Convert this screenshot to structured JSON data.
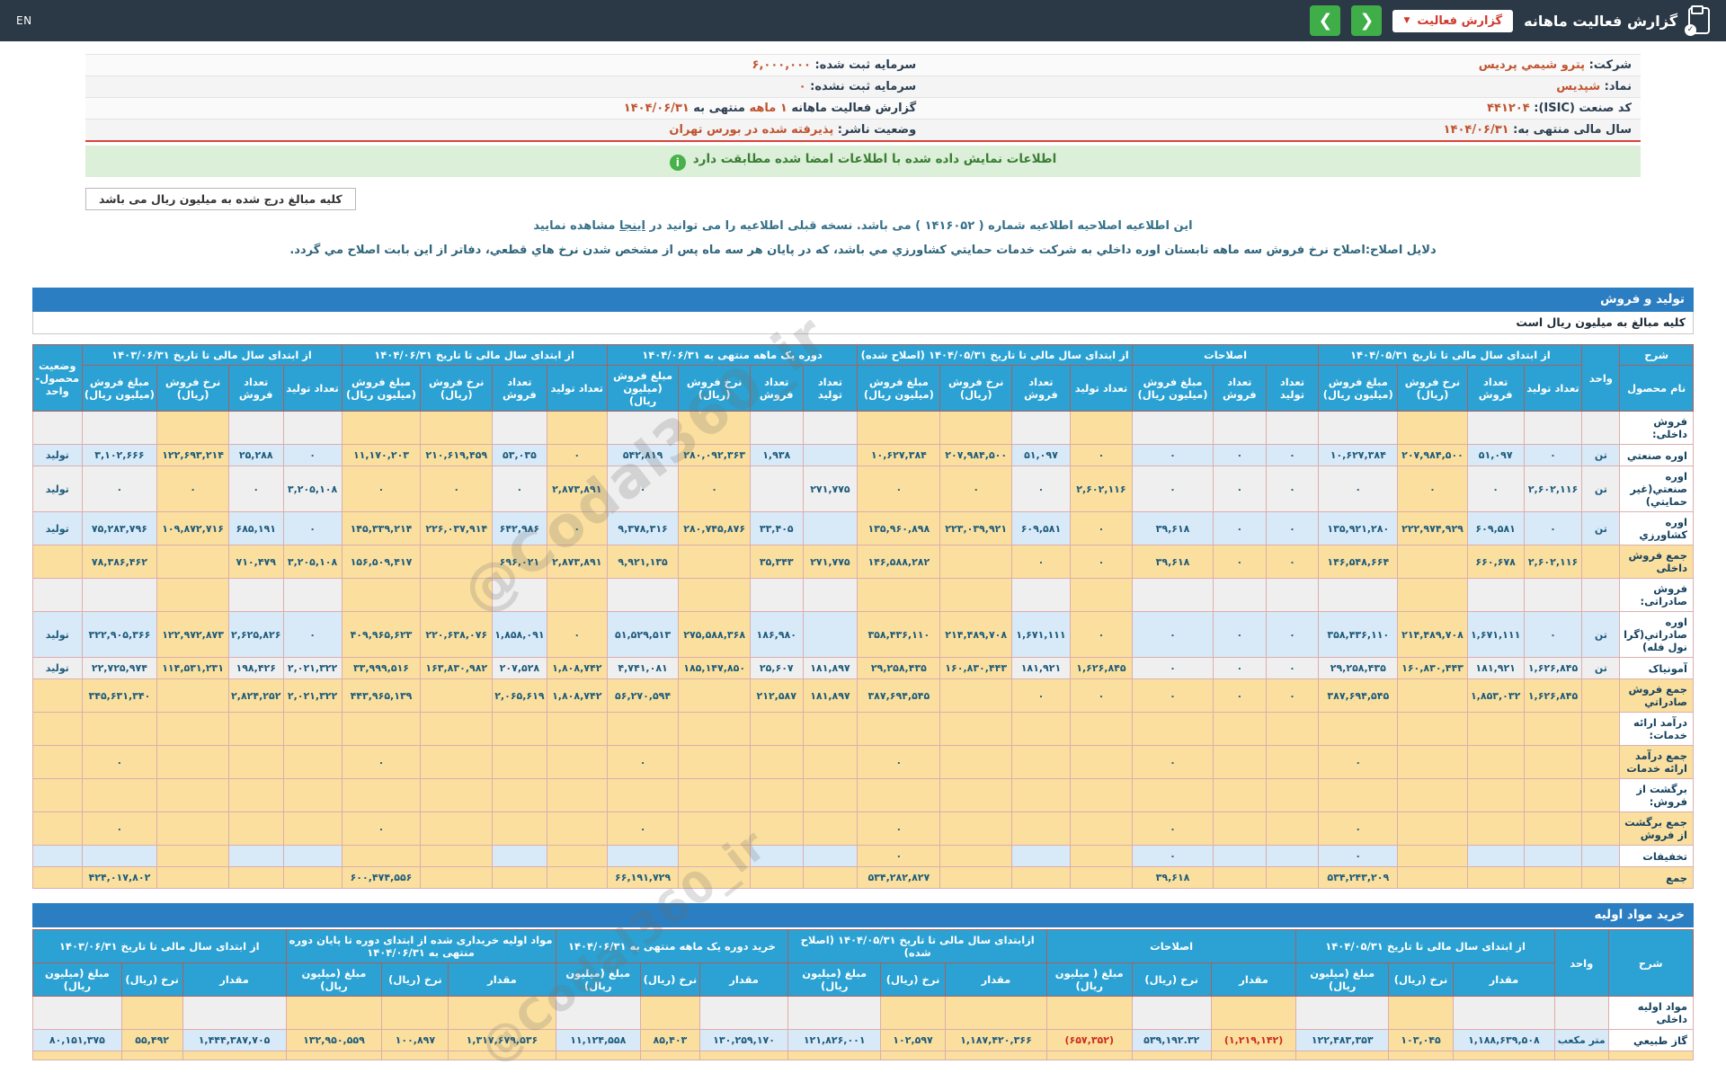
{
  "topbar": {
    "title": "گزارش فعالیت ماهانه",
    "dropdown_label": "گزارش فعالیت",
    "lang": "EN"
  },
  "info_rows": [
    {
      "r_label": "شرکت:",
      "r_value": "پترو شیمي پردیس",
      "l_label": "سرمایه ثبت شده:",
      "l_value": "۶,۰۰۰,۰۰۰"
    },
    {
      "r_label": "نماد:",
      "r_value": "شپدیس",
      "l_label": "سرمایه ثبت نشده:",
      "l_value": "۰"
    },
    {
      "r_label": "کد صنعت (ISIC):",
      "r_value": "۴۴۱۲۰۴",
      "l_label": "گزارش فعالیت ماهانه",
      "l_value": "۱ ماهه",
      "l_label2": "منتهی به",
      "l_value2": "۱۴۰۴/۰۶/۳۱"
    },
    {
      "r_label": "سال مالی منتهی به:",
      "r_value": "۱۴۰۴/۰۶/۳۱",
      "l_label": "وضعیت ناشر:",
      "l_value": "پذیرفته شده در بورس تهران"
    }
  ],
  "notice_text": "اطلاعات نمایش داده شده با اطلاعات امضا شده مطابقت دارد",
  "unit_note": "کلیه مبالغ درج شده به میلیون ریال می باشد",
  "amendment": {
    "before_link": "این اطلاعیه اصلاحیه اطلاعیه شماره ( ۱۴۱۶۰۵۲ ) می باشد. نسخه قبلی اطلاعیه را می توانید در ",
    "link_text": "اینجا",
    "after_link": " مشاهده نمایید",
    "reason": "دلایل اصلاح:اصلاح نرخ فروش سه ماهه تابستان اوره داخلي به شرکت خدمات حمایتي کشاورزي مي باشد، که در پایان هر سه ماه پس از مشخص شدن نرخ هاي قطعي، دفاتر از این بابت اصلاح مي گردد."
  },
  "watermark": "@Codal360_ir",
  "colors": {
    "accent_green": "#3fae49",
    "accent_red": "#cf3a2e",
    "header_cyan": "#2ba2d3",
    "bar_blue": "#2b7ec1",
    "wheat": "#fbdf9e"
  },
  "sales": {
    "bar_title": "تولید و فروش",
    "subtitle": "کلیه مبالغ به میلیون ریال است",
    "groups": [
      {
        "title": "شرح",
        "subs": [
          "نام محصول"
        ]
      },
      {
        "title": "واحد",
        "subs": []
      },
      {
        "title": "از ابتدای سال مالی تا تاریخ ۱۴۰۴/۰۵/۳۱",
        "subs": [
          "تعداد تولید",
          "تعداد فروش",
          "نرخ فروش (ریال)",
          "مبلغ فروش (میلیون ریال)"
        ]
      },
      {
        "title": "اصلاحات",
        "subs": [
          "تعداد تولید",
          "تعداد فروش",
          "مبلغ فروش (میلیون ریال)"
        ]
      },
      {
        "title": "از ابتدای سال مالی تا تاریخ ۱۴۰۴/۰۵/۳۱ (اصلاح شده)",
        "subs": [
          "تعداد تولید",
          "تعداد فروش",
          "نرخ فروش (ریال)",
          "مبلغ فروش (میلیون ریال)"
        ]
      },
      {
        "title": "دوره یک ماهه منتهی به ۱۴۰۴/۰۶/۳۱",
        "subs": [
          "تعداد تولید",
          "تعداد فروش",
          "نرخ فروش (ریال)",
          "مبلغ فروش (میلیون ریال)"
        ]
      },
      {
        "title": "از ابتدای سال مالی تا تاریخ ۱۴۰۴/۰۶/۳۱",
        "subs": [
          "تعداد تولید",
          "تعداد فروش",
          "نرخ فروش (ریال)",
          "مبلغ فروش (میلیون ریال)"
        ]
      },
      {
        "title": "از ابتدای سال مالی تا تاریخ ۱۴۰۳/۰۶/۳۱",
        "subs": [
          "تعداد تولید",
          "تعداد فروش",
          "نرخ فروش (ریال)",
          "مبلغ فروش (میلیون ریال)"
        ]
      },
      {
        "title": "وضعیت\nمحصول-واحد",
        "subs": []
      }
    ],
    "rows": [
      {
        "type": "section",
        "stripe": "g",
        "cells": [
          "فروش داخلی:"
        ]
      },
      {
        "type": "data",
        "stripe": "b",
        "cells": [
          "اوره صنعتي",
          "تن",
          "۰",
          "۵۱,۰۹۷",
          "۲۰۷,۹۸۴,۵۰۰",
          "۱۰,۶۲۷,۳۸۴",
          "۰",
          "۰",
          "۰",
          "۰",
          "۵۱,۰۹۷",
          "۲۰۷,۹۸۴,۵۰۰",
          "۱۰,۶۲۷,۳۸۴",
          "",
          "۱,۹۳۸",
          "۲۸۰,۰۹۲,۳۶۳",
          "۵۴۲,۸۱۹",
          "۰",
          "۵۳,۰۳۵",
          "۲۱۰,۶۱۹,۴۵۹",
          "۱۱,۱۷۰,۲۰۳",
          "۰",
          "۲۵,۲۸۸",
          "۱۲۲,۶۹۳,۲۱۴",
          "۳,۱۰۲,۶۶۶",
          "تولید"
        ]
      },
      {
        "type": "data",
        "stripe": "g",
        "cells": [
          "اوره صنعتي(غیر حمایتي)",
          "تن",
          "۲,۶۰۲,۱۱۶",
          "۰",
          "۰",
          "۰",
          "۰",
          "۰",
          "۰",
          "۲,۶۰۲,۱۱۶",
          "۰",
          "۰",
          "۰",
          "۲۷۱,۷۷۵",
          "",
          "۰",
          "۰",
          "۲,۸۷۳,۸۹۱",
          "۰",
          "۰",
          "۰",
          "۳,۲۰۵,۱۰۸",
          "۰",
          "۰",
          "۰",
          "تولید"
        ]
      },
      {
        "type": "data",
        "stripe": "b",
        "cells": [
          "اوره کشاورزي",
          "تن",
          "۰",
          "۶۰۹,۵۸۱",
          "۲۲۲,۹۷۴,۹۲۹",
          "۱۳۵,۹۲۱,۲۸۰",
          "۰",
          "۰",
          "۳۹,۶۱۸",
          "۰",
          "۶۰۹,۵۸۱",
          "۲۲۳,۰۳۹,۹۲۱",
          "۱۳۵,۹۶۰,۸۹۸",
          "",
          "۳۳,۴۰۵",
          "۲۸۰,۷۴۵,۸۷۶",
          "۹,۳۷۸,۳۱۶",
          "۰",
          "۶۴۲,۹۸۶",
          "۲۲۶,۰۳۷,۹۱۴",
          "۱۴۵,۳۳۹,۲۱۴",
          "۰",
          "۶۸۵,۱۹۱",
          "۱۰۹,۸۷۲,۷۱۶",
          "۷۵,۲۸۳,۷۹۶",
          "تولید"
        ]
      },
      {
        "type": "total",
        "stripe": "b",
        "cells": [
          "جمع فروش داخلی",
          "",
          "۲,۶۰۲,۱۱۶",
          "۶۶۰,۶۷۸",
          "",
          "۱۴۶,۵۴۸,۶۶۴",
          "۰",
          "۰",
          "۳۹,۶۱۸",
          "۰",
          "۰",
          "",
          "۱۴۶,۵۸۸,۲۸۲",
          "۲۷۱,۷۷۵",
          "۳۵,۳۴۳",
          "",
          "۹,۹۲۱,۱۳۵",
          "۲,۸۷۳,۸۹۱",
          "۶۹۶,۰۲۱",
          "",
          "۱۵۶,۵۰۹,۴۱۷",
          "۳,۲۰۵,۱۰۸",
          "۷۱۰,۴۷۹",
          "",
          "۷۸,۳۸۶,۴۶۲",
          ""
        ]
      },
      {
        "type": "section",
        "stripe": "g",
        "cells": [
          "فروش صادراتی:"
        ]
      },
      {
        "type": "data",
        "stripe": "b",
        "cells": [
          "اوره صادراتي(گرانول فله)",
          "تن",
          "۰",
          "۱,۶۷۱,۱۱۱",
          "۲۱۴,۴۸۹,۷۰۸",
          "۳۵۸,۴۳۶,۱۱۰",
          "۰",
          "۰",
          "۰",
          "۰",
          "۱,۶۷۱,۱۱۱",
          "۲۱۴,۴۸۹,۷۰۸",
          "۳۵۸,۴۳۶,۱۱۰",
          "",
          "۱۸۶,۹۸۰",
          "۲۷۵,۵۸۸,۳۶۸",
          "۵۱,۵۲۹,۵۱۳",
          "۰",
          "۱,۸۵۸,۰۹۱",
          "۲۲۰,۶۳۸,۰۷۶",
          "۴۰۹,۹۶۵,۶۲۳",
          "۰",
          "۲,۶۲۵,۸۲۶",
          "۱۲۲,۹۷۲,۸۷۳",
          "۳۲۲,۹۰۵,۳۶۶",
          "تولید"
        ]
      },
      {
        "type": "data",
        "stripe": "g",
        "cells": [
          "آمونیاک",
          "تن",
          "۱,۶۲۶,۸۴۵",
          "۱۸۱,۹۲۱",
          "۱۶۰,۸۳۰,۴۴۳",
          "۲۹,۲۵۸,۴۳۵",
          "۰",
          "۰",
          "۰",
          "۱,۶۲۶,۸۴۵",
          "۱۸۱,۹۲۱",
          "۱۶۰,۸۳۰,۴۴۳",
          "۲۹,۲۵۸,۴۳۵",
          "۱۸۱,۸۹۷",
          "۲۵,۶۰۷",
          "۱۸۵,۱۴۷,۸۵۰",
          "۴,۷۴۱,۰۸۱",
          "۱,۸۰۸,۷۴۲",
          "۲۰۷,۵۲۸",
          "۱۶۳,۸۳۰,۹۸۲",
          "۳۳,۹۹۹,۵۱۶",
          "۲,۰۲۱,۳۲۲",
          "۱۹۸,۴۲۶",
          "۱۱۴,۵۳۱,۲۳۱",
          "۲۲,۷۲۵,۹۷۴",
          "تولید"
        ]
      },
      {
        "type": "total",
        "stripe": "b",
        "cells": [
          "جمع فروش صادراتي",
          "",
          "۱,۶۲۶,۸۴۵",
          "۱,۸۵۳,۰۳۲",
          "",
          "۳۸۷,۶۹۴,۵۴۵",
          "۰",
          "۰",
          "۰",
          "۰",
          "۰",
          "",
          "۳۸۷,۶۹۴,۵۴۵",
          "۱۸۱,۸۹۷",
          "۲۱۲,۵۸۷",
          "",
          "۵۶,۲۷۰,۵۹۴",
          "۱,۸۰۸,۷۴۲",
          "۲,۰۶۵,۶۱۹",
          "",
          "۴۴۳,۹۶۵,۱۳۹",
          "۲,۰۲۱,۳۲۲",
          "۲,۸۲۴,۲۵۲",
          "",
          "۳۴۵,۶۳۱,۳۴۰",
          ""
        ]
      },
      {
        "type": "sectionW",
        "stripe": "g",
        "cells": [
          "درآمد ارائه خدمات:"
        ]
      },
      {
        "type": "total",
        "stripe": "b",
        "cells": [
          "جمع درآمد ارائه خدمات",
          "",
          "",
          "",
          "",
          "۰",
          "",
          "",
          "۰",
          "",
          "",
          "",
          "۰",
          "",
          "",
          "",
          "۰",
          "",
          "",
          "",
          "۰",
          "",
          "",
          "",
          "۰",
          ""
        ]
      },
      {
        "type": "sectionW",
        "stripe": "g",
        "cells": [
          "برگشت از فروش:"
        ]
      },
      {
        "type": "total",
        "stripe": "b",
        "cells": [
          "جمع برگشت از فروش",
          "",
          "",
          "",
          "",
          "۰",
          "",
          "",
          "۰",
          "",
          "",
          "",
          "۰",
          "",
          "",
          "",
          "۰",
          "",
          "",
          "",
          "۰",
          "",
          "",
          "",
          "۰",
          ""
        ]
      },
      {
        "type": "data",
        "stripe": "b",
        "cells": [
          "تخفیفات",
          "",
          "",
          "",
          "",
          "۰",
          "",
          "",
          "۰",
          "",
          "",
          "",
          "۰",
          "",
          "",
          "",
          "",
          "",
          "",
          "",
          "",
          "",
          "",
          "",
          "",
          ""
        ]
      },
      {
        "type": "total",
        "stripe": "b",
        "cells": [
          "جمع",
          "",
          "",
          "",
          "",
          "۵۳۴,۲۴۳,۲۰۹",
          "",
          "",
          "۳۹,۶۱۸",
          "",
          "",
          "",
          "۵۳۴,۲۸۲,۸۲۷",
          "",
          "",
          "",
          "۶۶,۱۹۱,۷۲۹",
          "",
          "",
          "",
          "۶۰۰,۴۷۴,۵۵۶",
          "",
          "",
          "",
          "۴۲۴,۰۱۷,۸۰۲",
          ""
        ]
      }
    ]
  },
  "materials": {
    "bar_title": "خرید مواد اولیه",
    "groups": [
      {
        "title": "شرح",
        "subs": []
      },
      {
        "title": "واحد",
        "subs": []
      },
      {
        "title": "از ابتدای سال مالی تا تاریخ ۱۴۰۴/۰۵/۳۱",
        "subs": [
          "مقدار",
          "نرخ (ریال)",
          "مبلغ (میلیون ریال)"
        ]
      },
      {
        "title": "اصلاحات",
        "subs": [
          "مقدار",
          "نرخ (ریال)",
          "مبلغ ( میلیون ریال)"
        ]
      },
      {
        "title": "ازابتدای سال مالی تا تاریخ ۱۴۰۴/۰۵/۳۱ (اصلاح شده)",
        "subs": [
          "مقدار",
          "نرخ (ریال)",
          "مبلغ (میلیون ریال)"
        ]
      },
      {
        "title": "خرید دوره یک ماهه منتهی به ۱۴۰۴/۰۶/۳۱",
        "subs": [
          "مقدار",
          "نرخ (ریال)",
          "مبلغ (میلیون ریال)"
        ]
      },
      {
        "title": "مواد اولیه خریداری شده از ابتدای دوره تا پایان دوره منتهی به ۱۴۰۴/۰۶/۳۱",
        "subs": [
          "مقدار",
          "نرخ (ریال)",
          "مبلغ (میلیون ریال)"
        ]
      },
      {
        "title": "از ابتدای سال مالی تا تاریخ ۱۴۰۳/۰۶/۳۱",
        "subs": [
          "مقدار",
          "نرخ (ریال)",
          "مبلغ (میلیون ریال)"
        ]
      }
    ],
    "rows": [
      {
        "type": "section",
        "stripe": "g",
        "cells": [
          "مواد اولیه داخلی"
        ]
      },
      {
        "type": "data",
        "stripe": "b",
        "cells": [
          "گاز طبیعي",
          "متر مکعب",
          "۱,۱۸۸,۶۳۹,۵۰۸",
          "۱۰۳,۰۴۵",
          "۱۲۲,۴۸۳,۳۵۳",
          "(۱,۲۱۹,۱۴۲)",
          "۵۳۹,۱۹۲.۳۲",
          "(۶۵۷,۳۵۲)",
          "۱,۱۸۷,۴۲۰,۳۶۶",
          "۱۰۲,۵۹۷",
          "۱۲۱,۸۲۶,۰۰۱",
          "۱۳۰,۲۵۹,۱۷۰",
          "۸۵,۴۰۳",
          "۱۱,۱۲۴,۵۵۸",
          "۱,۳۱۷,۶۷۹,۵۳۶",
          "۱۰۰,۸۹۷",
          "۱۳۲,۹۵۰,۵۵۹",
          "۱,۴۴۴,۳۸۷,۷۰۵",
          "۵۵,۴۹۲",
          "۸۰,۱۵۱,۳۷۵"
        ]
      },
      {
        "type": "cut",
        "stripe": "b",
        "cells": [
          ""
        ]
      }
    ]
  }
}
